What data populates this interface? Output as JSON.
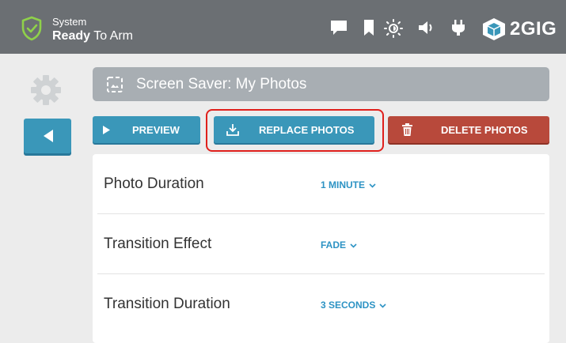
{
  "status": {
    "line1": "System",
    "line2_bold": "Ready",
    "line2_rest": " To Arm",
    "shield_color": "#8fd14a"
  },
  "header_icons": [
    "message-icon",
    "bookmark-icon",
    "brightness-icon",
    "volume-icon",
    "power-plug-icon"
  ],
  "brand": {
    "name": "2GIG",
    "accent": "#3a97b9"
  },
  "page_title": "Screen Saver: My Photos",
  "actions": {
    "preview": "PREVIEW",
    "replace": "REPLACE PHOTOS",
    "delete": "DELETE PHOTOS"
  },
  "colors": {
    "primary": "#3a97b9",
    "danger": "#b8493b",
    "highlight": "#e0201c",
    "value_text": "#2d93c4"
  },
  "settings": [
    {
      "label": "Photo Duration",
      "value": "1 MINUTE"
    },
    {
      "label": "Transition Effect",
      "value": "FADE"
    },
    {
      "label": "Transition Duration",
      "value": "3 SECONDS"
    }
  ]
}
